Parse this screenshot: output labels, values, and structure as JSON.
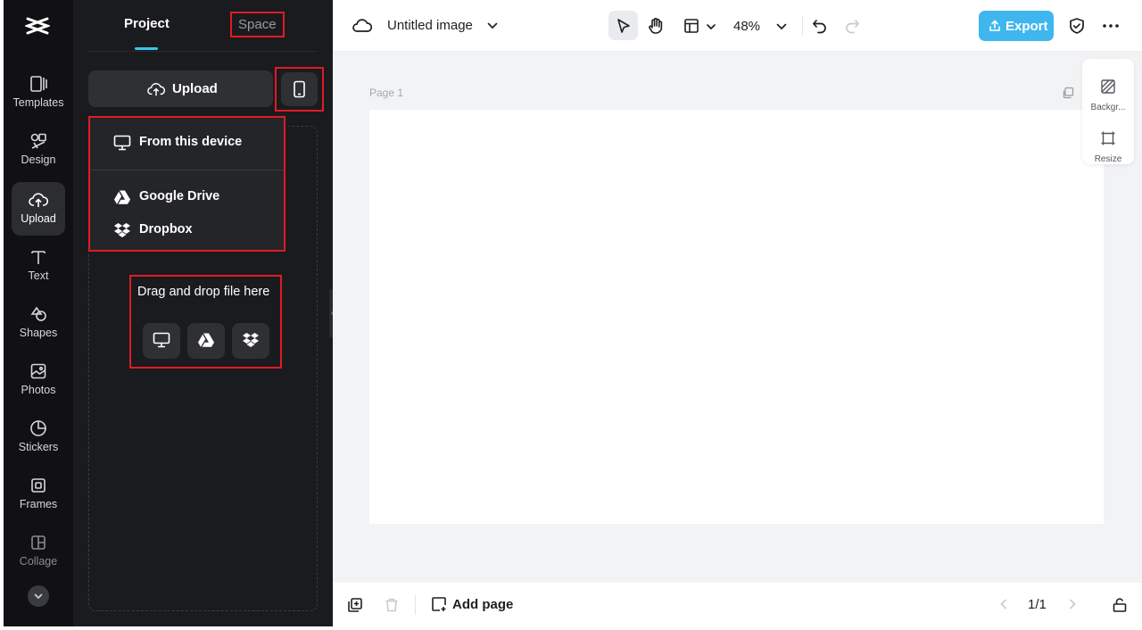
{
  "rail": {
    "items": [
      {
        "label": "Templates",
        "icon": "templates-icon"
      },
      {
        "label": "Design",
        "icon": "design-icon"
      },
      {
        "label": "Upload",
        "icon": "upload-cloud-icon"
      },
      {
        "label": "Text",
        "icon": "text-icon"
      },
      {
        "label": "Shapes",
        "icon": "shapes-icon"
      },
      {
        "label": "Photos",
        "icon": "photos-icon"
      },
      {
        "label": "Stickers",
        "icon": "stickers-icon"
      },
      {
        "label": "Frames",
        "icon": "frames-icon"
      },
      {
        "label": "Collage",
        "icon": "collage-icon"
      }
    ],
    "active_item": "Upload"
  },
  "panel": {
    "tabs": [
      "Project",
      "Space"
    ],
    "upload_label": "Upload",
    "menu": {
      "items": [
        "From this device",
        "Google Drive",
        "Dropbox"
      ]
    },
    "drag_text": "Drag and drop file here"
  },
  "topbar": {
    "title": "Untitled image",
    "zoom": "48%",
    "export_label": "Export"
  },
  "canvas": {
    "page_label": "Page 1",
    "float_panel": [
      "Backgr...",
      "Resize"
    ]
  },
  "bottombar": {
    "add_page_label": "Add page",
    "page_indicator": "1/1"
  },
  "colors": {
    "accent": "#37c8e8",
    "export": "#3fb7ee",
    "highlight_box": "#e01b24",
    "rail_bg": "#111113",
    "panel_bg": "#1a1b1e"
  }
}
